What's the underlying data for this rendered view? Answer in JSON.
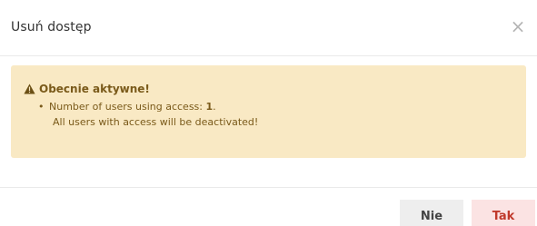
{
  "dialog": {
    "title": "Usuń dostęp",
    "close_label": "×"
  },
  "alert": {
    "title": "Obecnie aktywne!",
    "bullet": "•",
    "line1_text": "Number of users using access: ",
    "line1_value": "1",
    "line1_suffix": ".",
    "line2": "All users with access will be deactivated!"
  },
  "footer": {
    "no_label": "Nie",
    "yes_label": "Tak"
  },
  "colors": {
    "alert_bg": "#f9e9c4",
    "alert_text": "#7a5a1a",
    "no_bg": "#eeeeee",
    "yes_bg": "#fbe3e3",
    "yes_text": "#c0392b"
  }
}
